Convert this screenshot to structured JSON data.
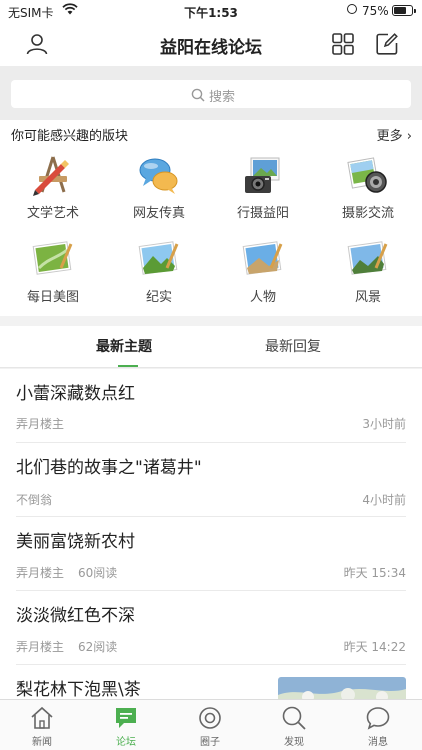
{
  "status_bar": {
    "carrier": "无SIM卡",
    "time": "下午1:53",
    "battery": "75%",
    "battery_level": 0.75
  },
  "nav": {
    "title": "益阳在线论坛",
    "icons": [
      "user-icon",
      "grid-icon",
      "compose-icon"
    ]
  },
  "search": {
    "placeholder": "搜索"
  },
  "forums": {
    "heading": "你可能感兴趣的版块",
    "more": "更多",
    "items": [
      {
        "label": "文学艺术",
        "icon": "art-icon"
      },
      {
        "label": "网友传真",
        "icon": "chat-bubbles-icon"
      },
      {
        "label": "行摄益阳",
        "icon": "camera-icon"
      },
      {
        "label": "摄影交流",
        "icon": "photo-lens-icon"
      },
      {
        "label": "每日美图",
        "icon": "picture-icon"
      },
      {
        "label": "纪实",
        "icon": "picture-icon"
      },
      {
        "label": "人物",
        "icon": "picture-icon"
      },
      {
        "label": "风景",
        "icon": "picture-icon"
      }
    ]
  },
  "tabs": [
    {
      "label": "最新主题",
      "active": true
    },
    {
      "label": "最新回复",
      "active": false
    }
  ],
  "posts": [
    {
      "title": "小蕾深藏数点红",
      "author": "弄月楼主",
      "views": "",
      "time": "3小时前"
    },
    {
      "title": "北们巷的故事之\"诸葛井\"",
      "author": "不倒翁",
      "views": "",
      "time": "4小时前"
    },
    {
      "title": "美丽富饶新农村",
      "author": "弄月楼主",
      "views": "60阅读",
      "time": "昨天 15:34"
    },
    {
      "title": "淡淡微红色不深",
      "author": "弄月楼主",
      "views": "62阅读",
      "time": "昨天 14:22"
    },
    {
      "title": "梨花林下泡黑\\茶",
      "author": "",
      "views": "",
      "time": ""
    }
  ],
  "tabbar": [
    {
      "label": "新闻",
      "icon": "home-icon",
      "active": false
    },
    {
      "label": "论坛",
      "icon": "forum-icon",
      "active": true
    },
    {
      "label": "圈子",
      "icon": "circle-icon",
      "active": false
    },
    {
      "label": "发现",
      "icon": "discover-icon",
      "active": false
    },
    {
      "label": "消息",
      "icon": "message-icon",
      "active": false
    }
  ],
  "colors": {
    "accent": "#4caf50",
    "background": "#f2f2f2"
  }
}
